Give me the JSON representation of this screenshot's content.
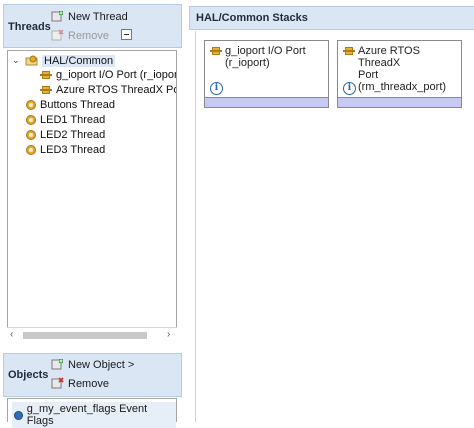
{
  "threads_panel": {
    "title": "Threads",
    "new_thread": "New Thread",
    "remove": "Remove"
  },
  "tree": {
    "items": [
      {
        "label": "HAL/Common",
        "icon": "folder-gear-icon"
      },
      {
        "label": "g_ioport I/O Port (r_ioport)",
        "icon": "module-icon"
      },
      {
        "label": "Azure RTOS ThreadX Port (r",
        "icon": "module-icon"
      },
      {
        "label": "Buttons Thread",
        "icon": "gear-icon"
      },
      {
        "label": "LED1 Thread",
        "icon": "gear-icon"
      },
      {
        "label": "LED2 Thread",
        "icon": "gear-icon"
      },
      {
        "label": "LED3 Thread",
        "icon": "gear-icon"
      }
    ]
  },
  "objects_panel": {
    "title": "Objects",
    "new_object": "New Object >",
    "remove": "Remove",
    "items": [
      {
        "label": "g_my_event_flags Event Flags"
      }
    ]
  },
  "stacks": {
    "title": "HAL/Common Stacks",
    "cards": [
      {
        "title_line1": "g_ioport I/O Port",
        "title_line2": "(r_ioport)",
        "title_line3": ""
      },
      {
        "title_line1": "Azure RTOS ThreadX",
        "title_line2": "Port",
        "title_line3": "(rm_threadx_port)"
      }
    ],
    "info_glyph": "i"
  },
  "colors": {
    "panel_header": "#dbe6f4",
    "card_bar": "#c6c9f2",
    "remove_red": "#d12b2b",
    "add_green": "#2f9a3a"
  }
}
